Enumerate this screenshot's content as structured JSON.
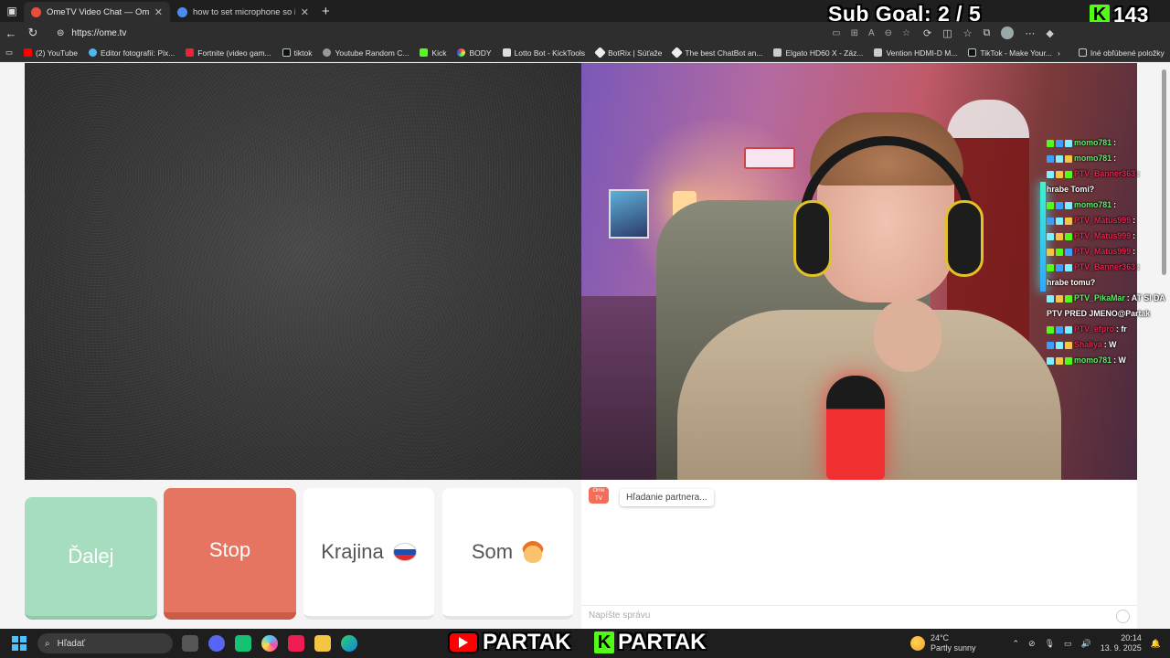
{
  "browser": {
    "tabs": [
      {
        "title": "OmeTV Video Chat — Ome",
        "active": true
      },
      {
        "title": "how to set microphone so it dont",
        "active": false
      }
    ],
    "url": "https://ome.tv",
    "bookmarks": [
      "(2) YouTube",
      "Editor fotografií: Pix...",
      "Fortnite (video gam...",
      "tiktok",
      "Youtube Random C...",
      "Kick",
      "BODY",
      "Lotto Bot - KickTools",
      "BotRix | Súťaže",
      "The best ChatBot an...",
      "Elgato HD60 X - Záz...",
      "Vention HDMI-D M...",
      "TikTok - Make Your..."
    ],
    "other_bookmarks": "Iné obľúbené položky"
  },
  "overlay": {
    "sub_goal": "Sub Goal:  2 / 5",
    "kick_count": "143",
    "kick_logo": "K"
  },
  "stream_chat": [
    {
      "nick": "momo781",
      "text": ":",
      "color": "green"
    },
    {
      "nick": "momo781",
      "text": ":",
      "color": "green"
    },
    {
      "nick": "PTV_Banner363",
      "text": ":",
      "color": "red"
    },
    {
      "nick": "",
      "text": "hrabe Tomi?",
      "color": "white"
    },
    {
      "nick": "momo781",
      "text": ":",
      "color": "green"
    },
    {
      "nick": "PTV_Matus999",
      "text": ":",
      "color": "red"
    },
    {
      "nick": "PTV_Matus999",
      "text": ":",
      "color": "red"
    },
    {
      "nick": "PTV_Matus999",
      "text": ":",
      "color": "red"
    },
    {
      "nick": "PTV_Banner363",
      "text": ":",
      "color": "red"
    },
    {
      "nick": "",
      "text": "hrabe tomu?",
      "color": "white"
    },
    {
      "nick": "PTV_PikaMar",
      "text": ": AT SI DA",
      "color": "green"
    },
    {
      "nick": "",
      "text": "PTV PRED JMENO@Partak",
      "color": "white"
    },
    {
      "nick": "PTV_efpro",
      "text": ": fr",
      "color": "red"
    },
    {
      "nick": "Shaliya",
      "text": ": W",
      "color": "red"
    },
    {
      "nick": "momo781",
      "text": ": W",
      "color": "green"
    }
  ],
  "controls": {
    "next_label": "Ďalej",
    "stop_label": "Stop",
    "country_label": "Krajina",
    "gender_label": "Som"
  },
  "text_chat": {
    "logo_text": "Ome TV",
    "status_message": "Hľadanie partnera...",
    "input_placeholder": "Napíšte správu"
  },
  "taskbar": {
    "search_placeholder": "Hľadať",
    "partak_youtube": "PARTAK",
    "partak_kick": "PARTAK",
    "kick_logo": "K",
    "weather_temp": "24°C",
    "weather_desc": "Partly sunny",
    "time": "20:14",
    "date": "13. 9. 2025"
  },
  "colors": {
    "next_button": "#a5ddbe",
    "stop_button": "#e57560",
    "kick_green": "#53fc18",
    "youtube_red": "#ff0000"
  }
}
